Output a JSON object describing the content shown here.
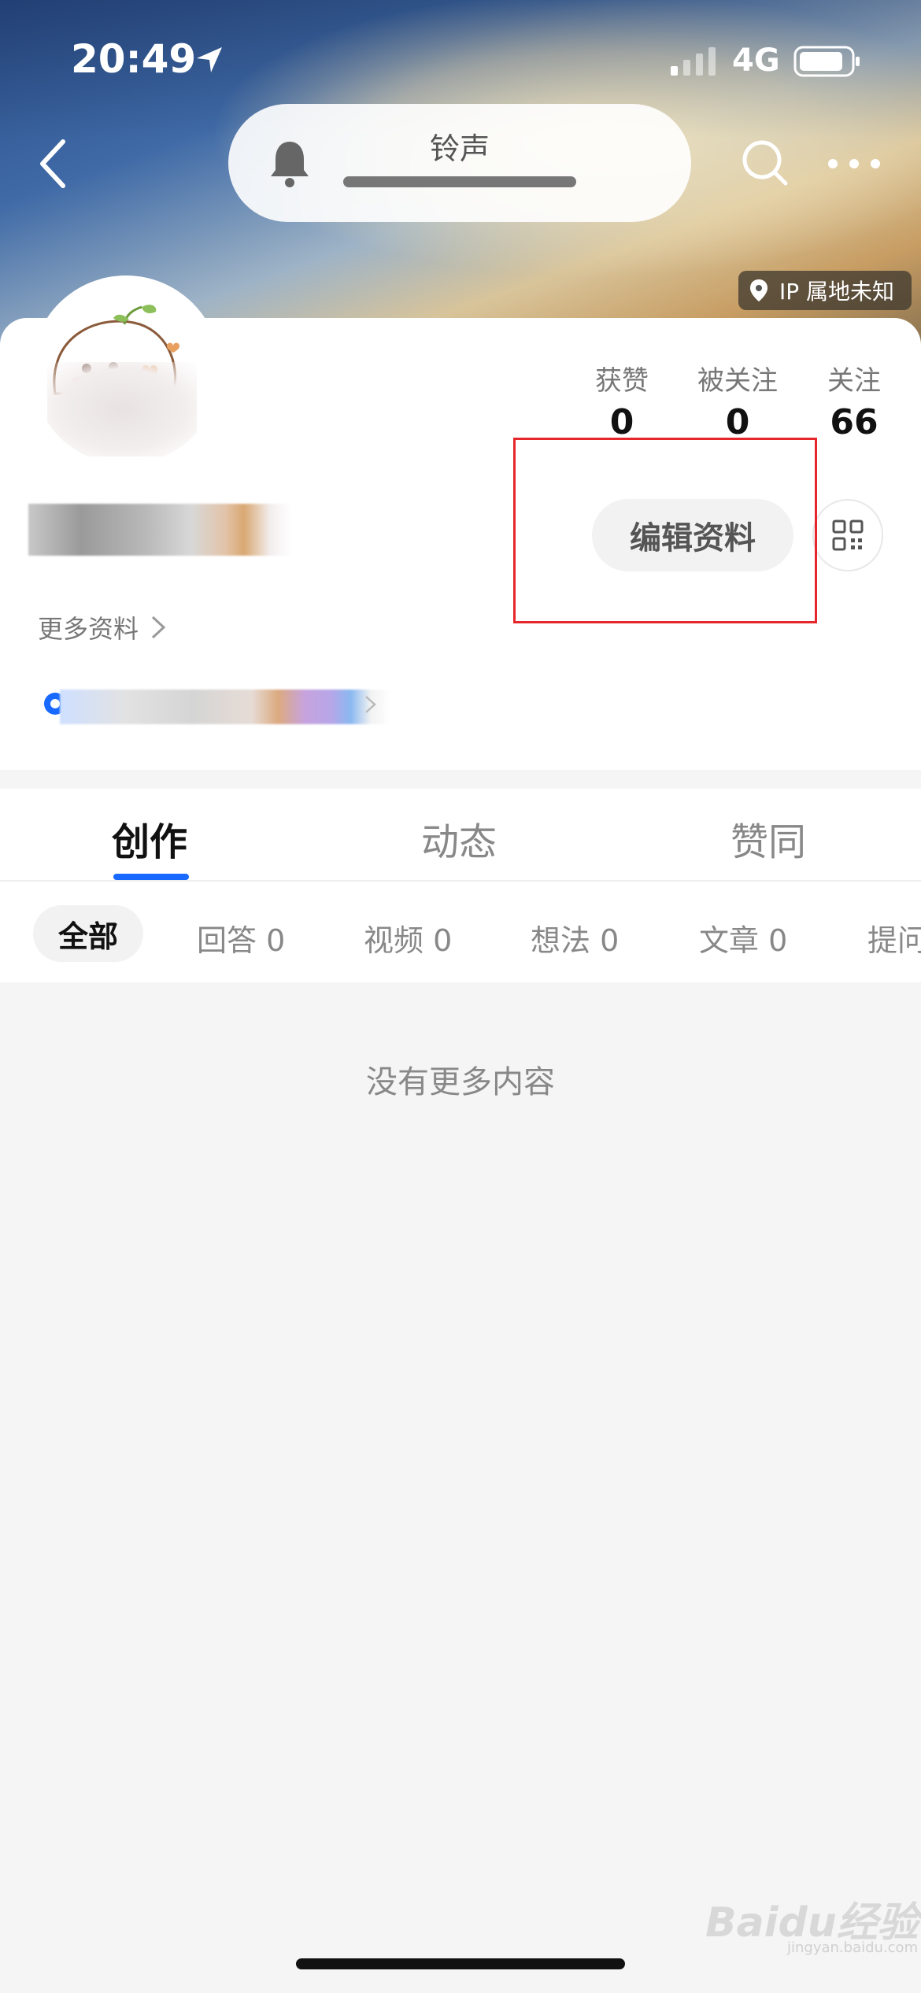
{
  "status_bar": {
    "time": "20:49",
    "network": "4G"
  },
  "header": {
    "ringtone_title": "铃声",
    "ip_location": "IP 属地未知"
  },
  "profile": {
    "stats": [
      {
        "label": "获赞",
        "value": "0"
      },
      {
        "label": "被关注",
        "value": "0"
      },
      {
        "label": "关注",
        "value": "66"
      }
    ],
    "edit_button": "编辑资料",
    "more_info": "更多资料"
  },
  "tabs": [
    "创作",
    "动态",
    "赞同"
  ],
  "filters": [
    "全部",
    "回答 0",
    "视频 0",
    "想法 0",
    "文章 0",
    "提问"
  ],
  "empty_state": "没有更多内容",
  "watermark": {
    "logo": "Baidu经验",
    "sub": "jingyan.baidu.com"
  },
  "colors": {
    "accent": "#1769ff",
    "highlight": "#e5262a"
  }
}
